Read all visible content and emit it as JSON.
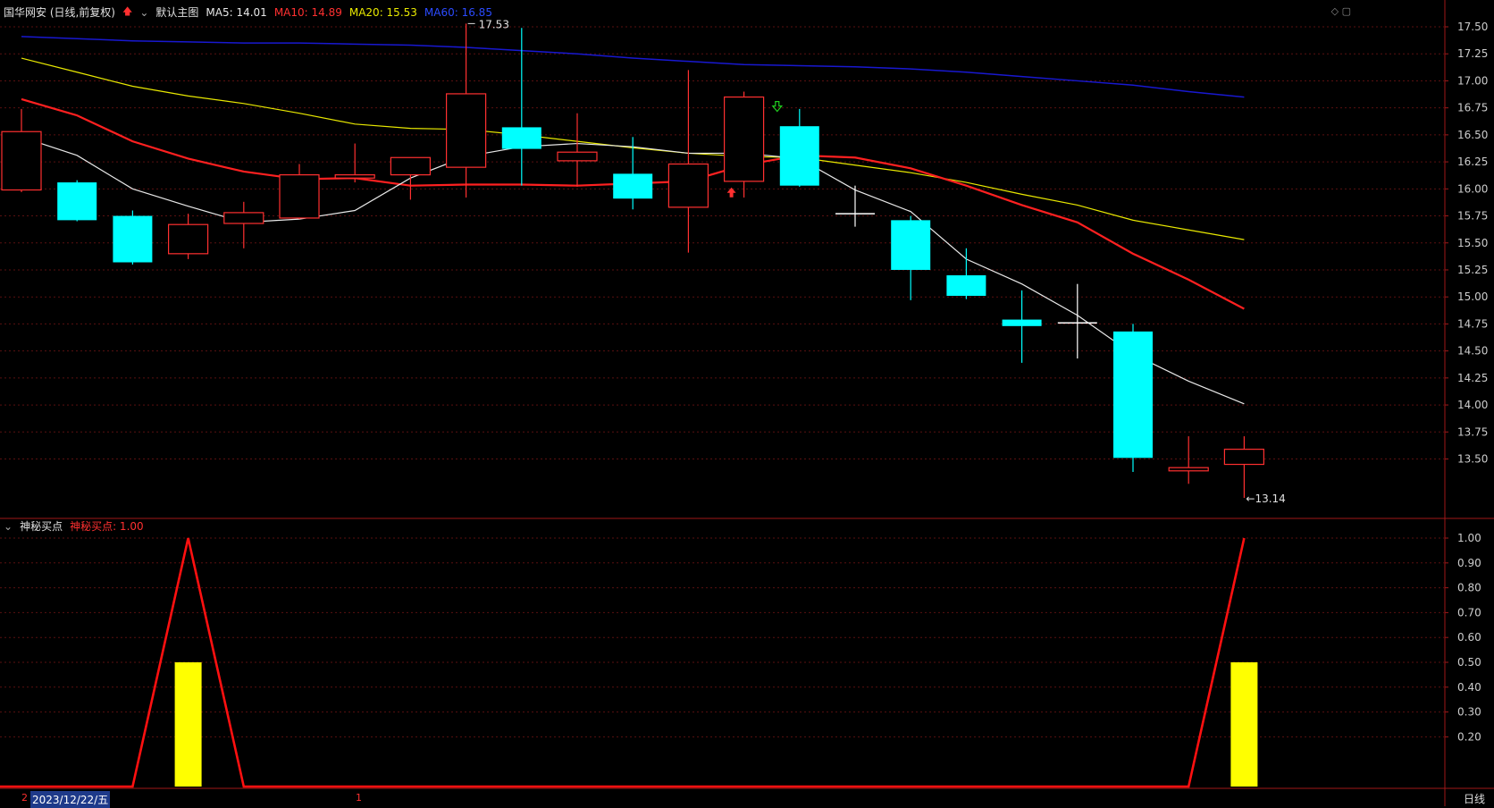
{
  "header": {
    "stock_title": "国华网安 (日线,前复权)",
    "template_name": "默认主图",
    "ma5": "MA5: 14.01",
    "ma10": "MA10: 14.89",
    "ma20": "MA20: 15.53",
    "ma60": "MA60: 16.85"
  },
  "indicator_header": {
    "name": "神秘买点",
    "value_text": "神秘买点: 1.00"
  },
  "footer": {
    "date_cursor": "2023/12/22/五",
    "left_marker": "2",
    "mid_marker": "1",
    "period": "日线"
  },
  "colors": {
    "up": "#ff3030",
    "down": "#00ffff",
    "ma5": "#e8e8e8",
    "ma10": "#ff2020",
    "ma20": "#e8e800",
    "ma60": "#1818d0",
    "grid": "#5a1010",
    "axis_text": "#cccccc",
    "indicator_line": "#ff1010",
    "indicator_bar": "#ffff00"
  },
  "chart_data": [
    {
      "type": "candlestick",
      "ylim": [
        13.0,
        17.62
      ],
      "yticks": [
        "17.50",
        "17.25",
        "17.00",
        "16.75",
        "16.50",
        "16.25",
        "16.00",
        "15.75",
        "15.50",
        "15.25",
        "15.00",
        "14.75",
        "14.50",
        "14.25",
        "14.00",
        "13.75",
        "13.50"
      ],
      "candles": [
        {
          "o": 15.99,
          "c": 16.53,
          "h": 16.74,
          "l": 15.97
        },
        {
          "o": 16.06,
          "c": 15.71,
          "h": 16.08,
          "l": 15.7
        },
        {
          "o": 15.75,
          "c": 15.32,
          "h": 15.8,
          "l": 15.3
        },
        {
          "o": 15.4,
          "c": 15.67,
          "h": 15.77,
          "l": 15.35
        },
        {
          "o": 15.68,
          "c": 15.78,
          "h": 15.88,
          "l": 15.45
        },
        {
          "o": 15.73,
          "c": 16.13,
          "h": 16.23,
          "l": 15.72
        },
        {
          "o": 16.1,
          "c": 16.13,
          "h": 16.42,
          "l": 16.06
        },
        {
          "o": 16.13,
          "c": 16.29,
          "h": 16.29,
          "l": 15.9
        },
        {
          "o": 16.2,
          "c": 16.88,
          "h": 17.53,
          "l": 15.92
        },
        {
          "o": 16.57,
          "c": 16.37,
          "h": 17.49,
          "l": 16.03
        },
        {
          "o": 16.26,
          "c": 16.34,
          "h": 16.7,
          "l": 16.02
        },
        {
          "o": 16.14,
          "c": 15.91,
          "h": 16.48,
          "l": 15.81
        },
        {
          "o": 15.83,
          "c": 16.23,
          "h": 17.1,
          "l": 15.41
        },
        {
          "o": 16.07,
          "c": 16.85,
          "h": 16.9,
          "l": 15.92
        },
        {
          "o": 16.58,
          "c": 16.03,
          "h": 16.74,
          "l": 16.02
        },
        {
          "o": 15.77,
          "c": 15.77,
          "h": 16.03,
          "l": 15.65
        },
        {
          "o": 15.71,
          "c": 15.25,
          "h": 15.75,
          "l": 14.97
        },
        {
          "o": 15.2,
          "c": 15.01,
          "h": 15.45,
          "l": 14.98
        },
        {
          "o": 14.79,
          "c": 14.73,
          "h": 15.06,
          "l": 14.39
        },
        {
          "o": 14.76,
          "c": 14.76,
          "h": 15.12,
          "l": 14.43
        },
        {
          "o": 14.68,
          "c": 13.51,
          "h": 14.75,
          "l": 13.38
        },
        {
          "o": 13.39,
          "c": 13.42,
          "h": 13.71,
          "l": 13.27
        },
        {
          "o": 13.45,
          "c": 13.59,
          "h": 13.71,
          "l": 13.14
        }
      ],
      "ma5": [
        16.48,
        16.31,
        16.0,
        15.84,
        15.69,
        15.72,
        15.8,
        16.1,
        16.3,
        16.39,
        16.42,
        16.39,
        16.33,
        16.33,
        16.28,
        15.99,
        15.79,
        15.35,
        15.12,
        14.83,
        14.47,
        14.22,
        14.01
      ],
      "ma10": [
        16.83,
        16.68,
        16.44,
        16.28,
        16.16,
        16.09,
        16.1,
        16.03,
        16.04,
        16.04,
        16.03,
        16.05,
        16.07,
        16.22,
        16.31,
        16.29,
        16.19,
        16.03,
        15.85,
        15.69,
        15.4,
        15.16,
        14.89
      ],
      "ma20": [
        17.21,
        17.08,
        16.95,
        16.86,
        16.79,
        16.7,
        16.6,
        16.56,
        16.55,
        16.5,
        16.44,
        16.38,
        16.33,
        16.3,
        16.29,
        16.22,
        16.15,
        16.06,
        15.95,
        15.85,
        15.71,
        15.62,
        15.53
      ],
      "ma60": [
        17.41,
        17.39,
        17.37,
        17.36,
        17.35,
        17.35,
        17.34,
        17.33,
        17.31,
        17.28,
        17.25,
        17.21,
        17.18,
        17.15,
        17.14,
        17.13,
        17.11,
        17.08,
        17.04,
        17.0,
        16.96,
        16.9,
        16.85
      ],
      "high_label": "17.53",
      "low_label": "13.14",
      "signals": [
        {
          "index": 13,
          "kind": "buy-arrow"
        },
        {
          "index": 14,
          "kind": "sell-arrow"
        },
        {
          "index": 15,
          "kind": "cross"
        }
      ]
    },
    {
      "type": "line+bar",
      "ylim": [
        0,
        1.05
      ],
      "yticks": [
        "1.00",
        "0.90",
        "0.80",
        "0.70",
        "0.60",
        "0.50",
        "0.40",
        "0.30",
        "0.20"
      ],
      "line_x": [
        -0.5,
        2.0,
        3.0,
        4.0,
        20.0,
        21.0,
        22.0
      ],
      "line_y": [
        0,
        0,
        1.0,
        0,
        0,
        0,
        1.0
      ],
      "bars": [
        {
          "index": 3,
          "value": 0.5
        },
        {
          "index": 22,
          "value": 0.5
        }
      ]
    }
  ]
}
